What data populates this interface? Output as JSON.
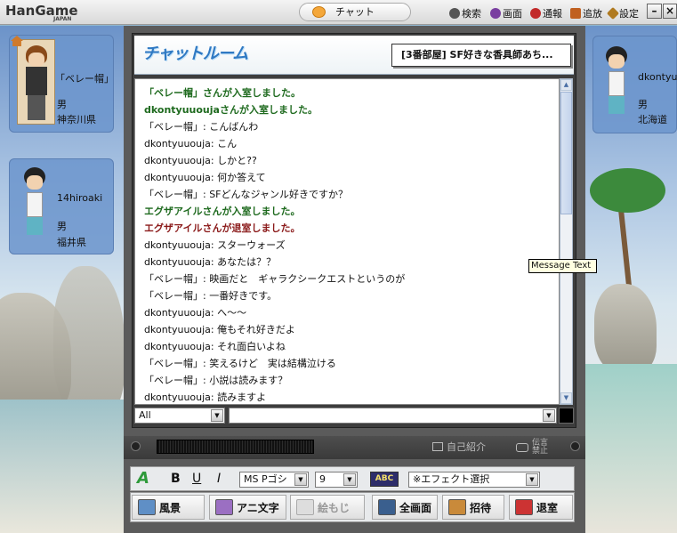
{
  "topbar": {
    "logo": "HanGame",
    "logo_sub": "JAPAN",
    "chat_tab": "チャット",
    "menu": [
      {
        "label": "検索",
        "icon": "search-icon",
        "color": "#555555"
      },
      {
        "label": "画面",
        "icon": "screen-icon",
        "color": "#7a3fa0"
      },
      {
        "label": "通報",
        "icon": "report-icon",
        "color": "#c22a2a"
      },
      {
        "label": "追放",
        "icon": "kick-icon",
        "color": "#c06020"
      },
      {
        "label": "設定",
        "icon": "settings-icon",
        "color": "#b07a20"
      }
    ]
  },
  "left_users": [
    {
      "name": "「ベレー帽」",
      "gender": "男",
      "region": "神奈川県"
    },
    {
      "name": "14hiroaki",
      "gender": "男",
      "region": "福井県"
    }
  ],
  "right_users": [
    {
      "name": "dkontyuuouja",
      "gender": "男",
      "region": "北海道"
    }
  ],
  "chat": {
    "title": "チャットルーム",
    "room_name": "[3番部屋] SF好きな香具師あち...",
    "messages": [
      {
        "text": "「ベレー帽」さんが入室しました。",
        "type": "enter"
      },
      {
        "text": "dkontyuuoujaさんが入室しました。",
        "type": "enter"
      },
      {
        "text": "「ベレー帽」: こんばんわ",
        "type": "normal"
      },
      {
        "text": "dkontyuuouja: こん",
        "type": "normal"
      },
      {
        "text": "dkontyuuouja: しかと??",
        "type": "normal"
      },
      {
        "text": "dkontyuuouja: 何か答えて",
        "type": "normal"
      },
      {
        "text": "「ベレー帽」: SFどんなジャンル好きですか？",
        "type": "normal"
      },
      {
        "text": "エグザアイルさんが入室しました。",
        "type": "enter"
      },
      {
        "text": "エグザアイルさんが退室しました。",
        "type": "leave"
      },
      {
        "text": "dkontyuuouja: スターウォーズ",
        "type": "normal"
      },
      {
        "text": "dkontyuuouja: あなたは？？",
        "type": "normal"
      },
      {
        "text": "「ベレー帽」: 映画だと　ギャラクシークエストというのが",
        "type": "normal"
      },
      {
        "text": "「ベレー帽」: 一番好きです。",
        "type": "normal"
      },
      {
        "text": "dkontyuuouja: へ〜〜",
        "type": "normal"
      },
      {
        "text": "dkontyuuouja: 俺もそれ好きだよ",
        "type": "normal"
      },
      {
        "text": "dkontyuuouja: それ面白いよね",
        "type": "normal"
      },
      {
        "text": "「ベレー帽」: 笑えるけど　実は結構泣ける",
        "type": "normal"
      },
      {
        "text": "「ベレー帽」: 小説は読みます？",
        "type": "normal"
      },
      {
        "text": "dkontyuuouja: 読みますよ",
        "type": "normal"
      }
    ],
    "tooltip": "Message Text",
    "target_select": "All",
    "message_input": ""
  },
  "ledbar": {
    "self_intro": "自己紹介",
    "mute": "伝言禁止"
  },
  "format_toolbar": {
    "bold": "B",
    "underline": "U",
    "italic": "I",
    "font": "MS Pゴシ",
    "size": "9",
    "abc": "ABC",
    "effect": "※エフェクト選択"
  },
  "action_toolbar": {
    "scenery": "風景",
    "anime_text": "アニ文字",
    "emoji": "絵もじ",
    "fullscreen": "全画面",
    "invite": "招待",
    "leave": "退室"
  }
}
